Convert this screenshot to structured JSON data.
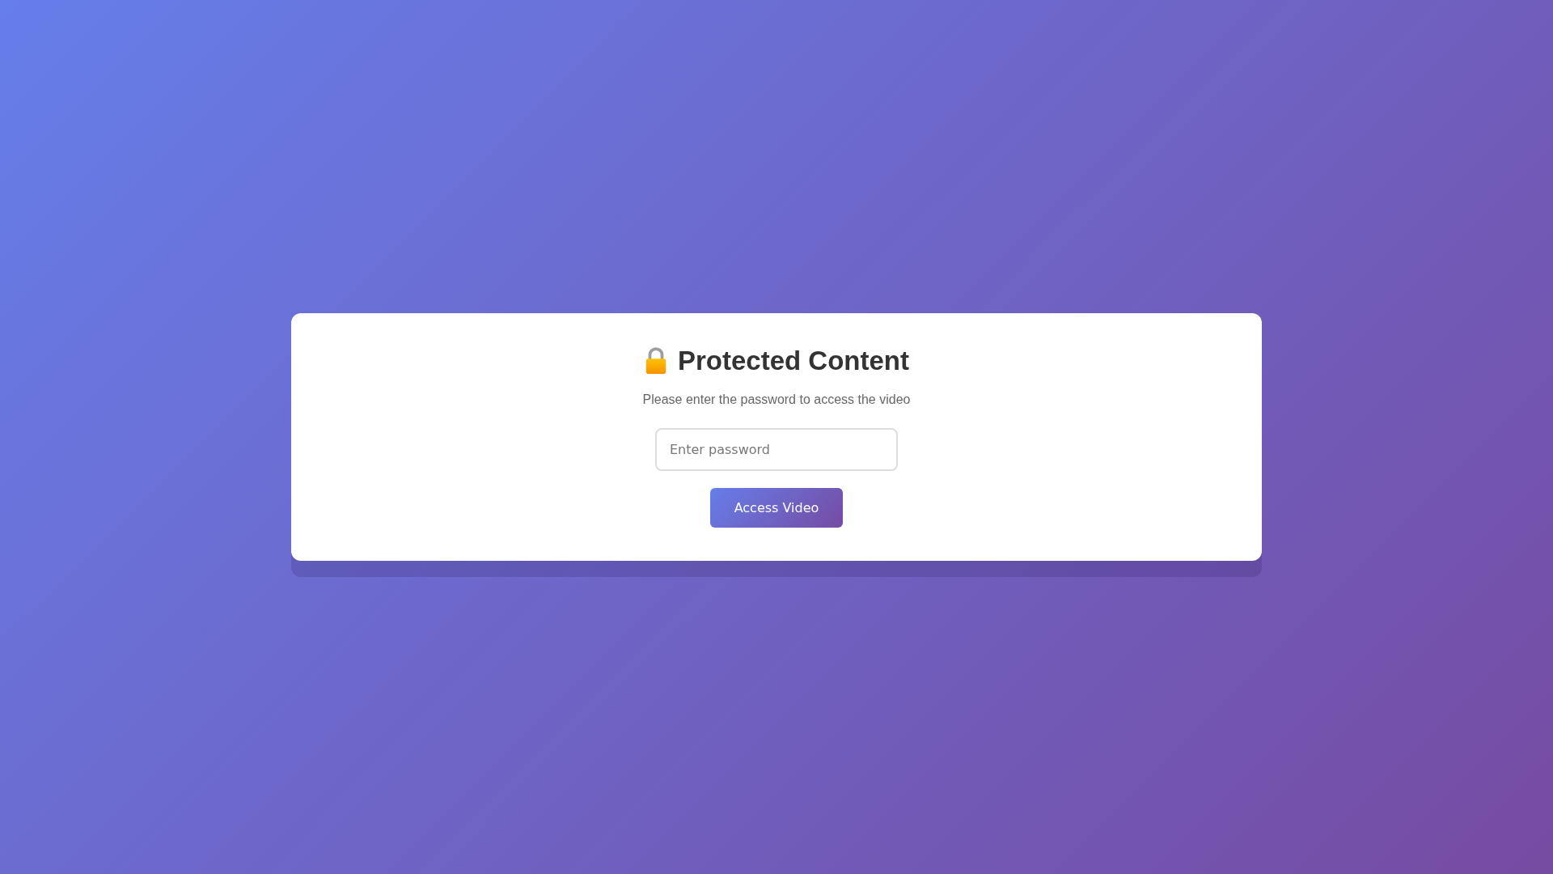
{
  "card": {
    "title": "Protected Content",
    "subtitle": "Please enter the password to access the video",
    "password_field": {
      "placeholder": "Enter password"
    },
    "button": "Access Video"
  }
}
